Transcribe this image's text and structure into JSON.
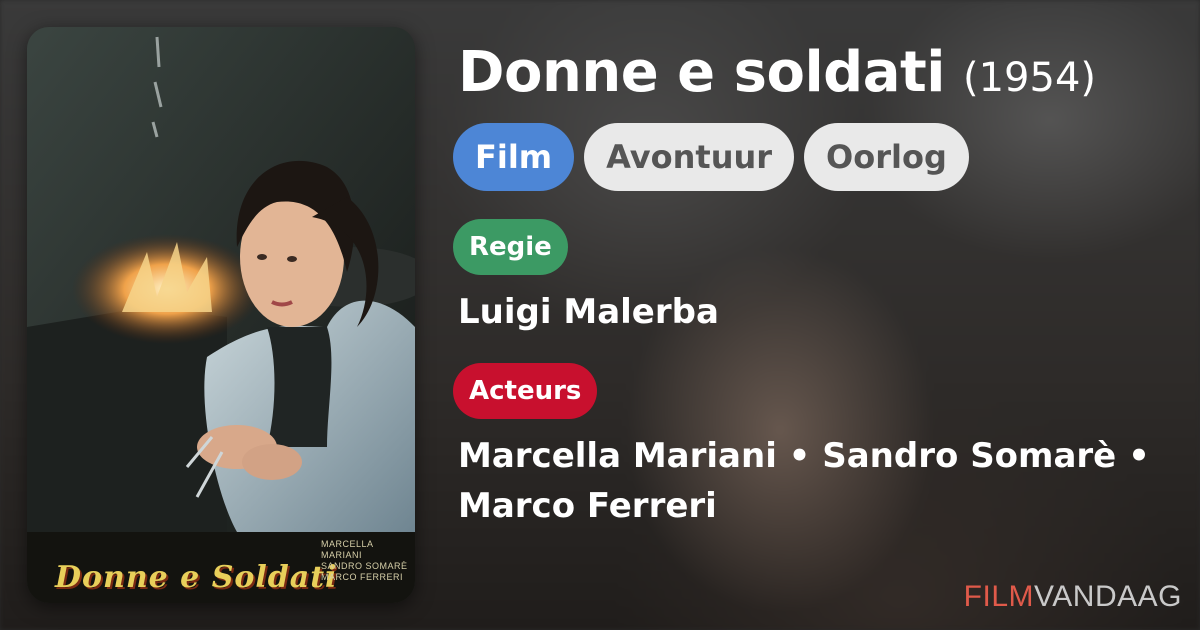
{
  "movie": {
    "title": "Donne e soldati",
    "year": "(1954)"
  },
  "genres": [
    {
      "label": "Film",
      "style": "primary"
    },
    {
      "label": "Avontuur",
      "style": "secondary"
    },
    {
      "label": "Oorlog",
      "style": "secondary"
    }
  ],
  "director": {
    "label": "Regie",
    "name": "Luigi Malerba"
  },
  "cast": {
    "label": "Acteurs",
    "line1": "Marcella Mariani • Sandro Somarè •",
    "line2": "Marco Ferreri"
  },
  "poster": {
    "logo_text": "Donne e Soldati",
    "credit_1": "MARCELLA MARIANI",
    "credit_2": "SANDRO SOMARÈ",
    "credit_3": "MARCO FERRERI"
  },
  "brand": {
    "part1": "FILM",
    "part2": "VANDAAG"
  },
  "colors": {
    "film_tag": "#4d86d6",
    "regie": "#3c9a64",
    "acteurs": "#c8102e",
    "brand_accent": "#e05a4a"
  }
}
